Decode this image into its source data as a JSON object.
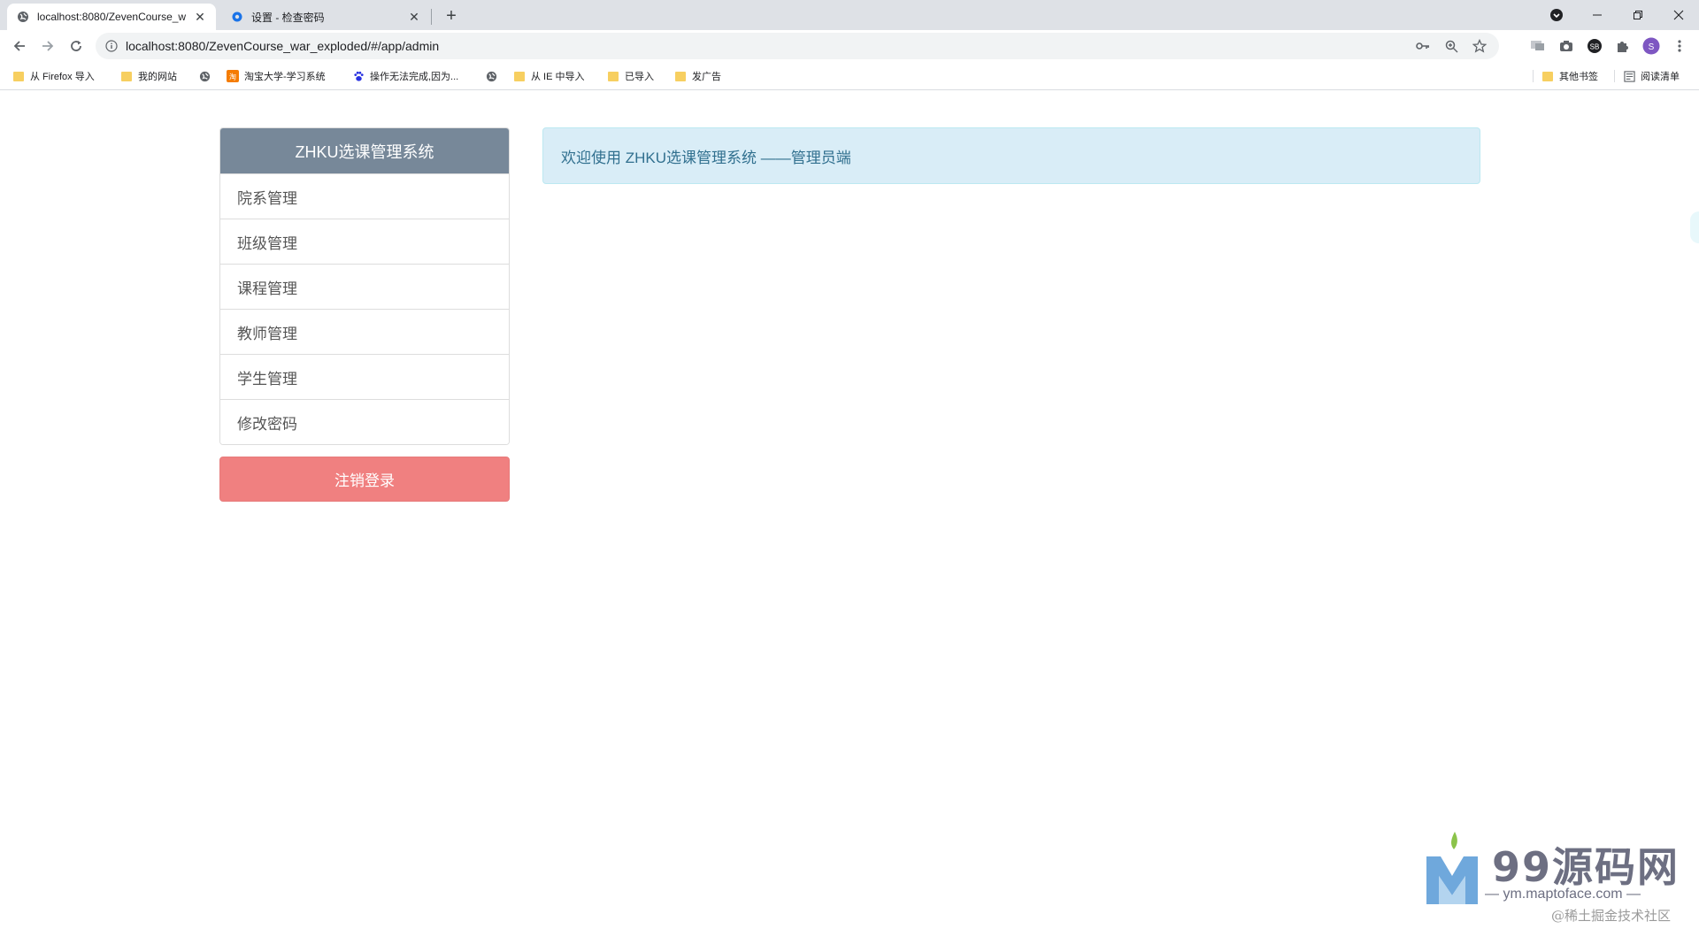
{
  "browser": {
    "tabs": [
      {
        "title": "localhost:8080/ZevenCourse_w",
        "active": true
      },
      {
        "title": "设置 - 检查密码",
        "active": false
      }
    ],
    "new_tab_label": "+",
    "url": "localhost:8080/ZevenCourse_war_exploded/#/app/admin",
    "profile_initial": "S",
    "ext_badge": "SB",
    "bookmarks": [
      {
        "label": "从 Firefox 导入",
        "icon": "folder-icon"
      },
      {
        "label": "我的网站",
        "icon": "folder-icon"
      },
      {
        "label": "",
        "icon": "globe-icon"
      },
      {
        "label": "淘宝大学-学习系统",
        "icon": "taobao-icon"
      },
      {
        "label": "操作无法完成,因为...",
        "icon": "baidu-paw-icon"
      },
      {
        "label": "",
        "icon": "globe-icon"
      },
      {
        "label": "从 IE 中导入",
        "icon": "folder-icon"
      },
      {
        "label": "已导入",
        "icon": "folder-icon"
      },
      {
        "label": "发广告",
        "icon": "folder-icon"
      }
    ],
    "other_bookmarks": "其他书签",
    "reading_list": "阅读清单"
  },
  "sidebar": {
    "title": "ZHKU选课管理系统",
    "items": [
      {
        "label": "院系管理"
      },
      {
        "label": "班级管理"
      },
      {
        "label": "课程管理"
      },
      {
        "label": "教师管理"
      },
      {
        "label": "学生管理"
      },
      {
        "label": "修改密码"
      }
    ],
    "logout_label": "注销登录"
  },
  "main": {
    "welcome_text": "欢迎使用 ZHKU选课管理系统 ——管理员端"
  },
  "watermark": {
    "title": "99源码网",
    "url": "— ym.maptoface.com —",
    "credit": "@稀土掘金技术社区"
  },
  "colors": {
    "sidebar_header": "#778899",
    "logout": "#f08080",
    "welcome_bg": "#d9edf7",
    "welcome_text": "#31708f"
  }
}
